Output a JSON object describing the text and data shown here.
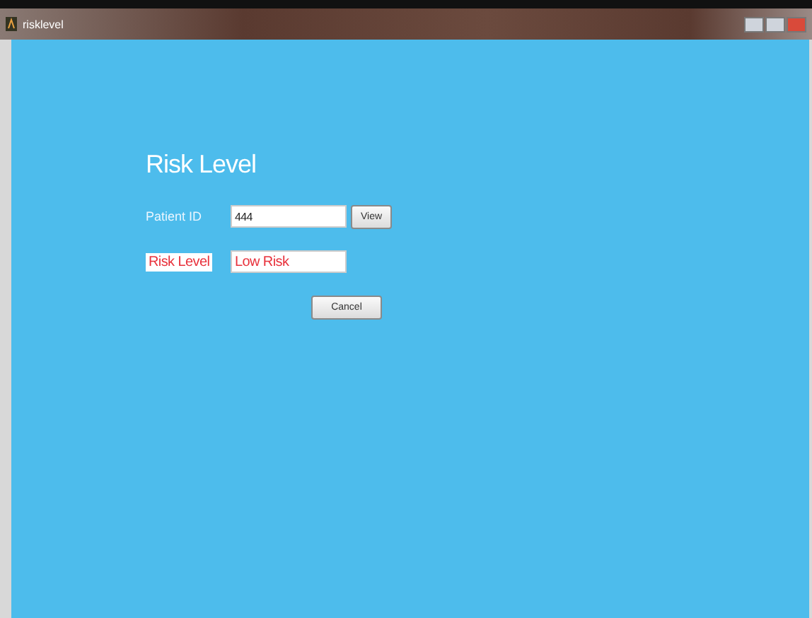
{
  "window": {
    "title": "risklevel"
  },
  "heading": "Risk Level",
  "patient_id": {
    "label": "Patient ID",
    "value": "444"
  },
  "view_button": "View",
  "risk_level": {
    "label": "Risk Level",
    "value": "Low Risk"
  },
  "cancel_button": "Cancel"
}
